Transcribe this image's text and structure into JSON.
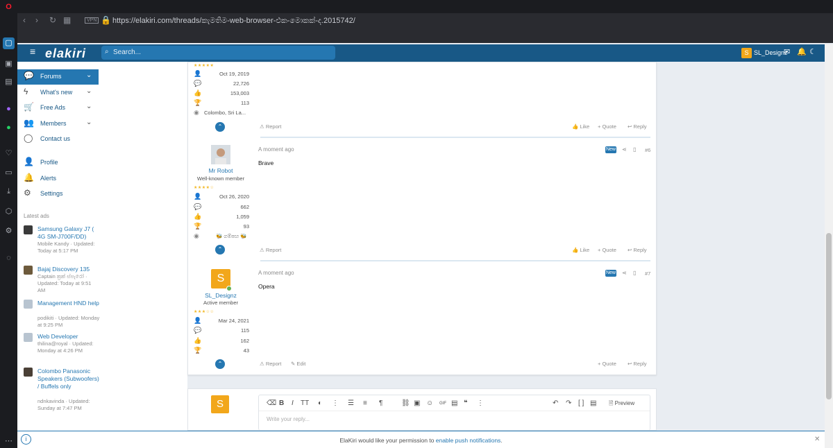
{
  "browser": {
    "url": "https://elakiri.com/threads/කැමතිම-web-browser-එක-මොකක්-ද.2015742/",
    "vpn_label": "VPN"
  },
  "header": {
    "logo": "elakiri",
    "search_placeholder": "Search...",
    "user_initial": "S",
    "username": "SL_Designz"
  },
  "nav": {
    "items": [
      {
        "label": "Forums",
        "icon": "chat-icon",
        "has_chevron": true,
        "active": true
      },
      {
        "label": "What's new",
        "icon": "lightning-icon",
        "has_chevron": true
      },
      {
        "label": "Free Ads",
        "icon": "cart-icon",
        "has_chevron": true
      },
      {
        "label": "Members",
        "icon": "members-icon",
        "has_chevron": true
      },
      {
        "label": "Contact us",
        "icon": "contact-icon",
        "has_chevron": false
      },
      {
        "label": "Profile",
        "icon": "user-icon",
        "has_chevron": false
      },
      {
        "label": "Alerts",
        "icon": "bell-icon",
        "has_chevron": false
      },
      {
        "label": "Settings",
        "icon": "gear-icon",
        "has_chevron": false
      }
    ],
    "latest_ads_title": "Latest ads",
    "ads": [
      {
        "title": "Samsung Galaxy J7 ( 4G SM-J700F/DD)",
        "meta": "Mobile Kandy · Updated: Today at 5:17 PM"
      },
      {
        "title": "Bajaj Discovery 135",
        "meta": "Captain ක්‍රක් ස්පැරෝ · Updated: Today at 9:51 AM"
      },
      {
        "title": "Management HND help",
        "meta": "podikiti · Updated: Monday at 9:25 PM"
      },
      {
        "title": "Web Developer",
        "meta": "thilina@royal · Updated: Monday at 4:26 PM"
      },
      {
        "title": "Colombo Panasonic Speakers (Subwoofers) / Buffels only",
        "meta": "ndnkavinda · Updated: Sunday at 7:47 PM"
      }
    ]
  },
  "posts": [
    {
      "stats": [
        "Oct 19, 2019",
        "22,726",
        "153,003",
        "113"
      ],
      "location": "Colombo, Sri La...",
      "actions": {
        "report": "Report",
        "like": "Like",
        "quote": "+ Quote",
        "reply": "Reply"
      }
    },
    {
      "username": "Mr Robot",
      "user_title": "Well-known member",
      "timestamp": "A moment ago",
      "body": "Brave",
      "badge": "New",
      "number": "#6",
      "stats": [
        "Oct 26, 2020",
        "662",
        "1,059",
        "93"
      ],
      "location": "🐝 ගම්පහ 🐝",
      "actions": {
        "report": "Report",
        "like": "Like",
        "quote": "+ Quote",
        "reply": "Reply"
      }
    },
    {
      "avatar_initial": "S",
      "username": "SL_Designz",
      "user_title": "Active member",
      "timestamp": "A moment ago",
      "body": "Opera",
      "badge": "New",
      "number": "#7",
      "stats": [
        "Mar 24, 2021",
        "115",
        "162",
        "43"
      ],
      "actions": {
        "report": "Report",
        "edit": "Edit",
        "quote": "+ Quote",
        "reply": "Reply"
      }
    }
  ],
  "reply_box": {
    "avatar_initial": "S",
    "placeholder": "Write your reply...",
    "preview": "Preview"
  },
  "notice": {
    "text_before": "ElaKiri would like your permission to ",
    "link": "enable push notifications",
    "text_after": "."
  },
  "colors": {
    "header": "#185886",
    "accent": "#2577b1",
    "avatar_orange": "#f2a71b"
  }
}
